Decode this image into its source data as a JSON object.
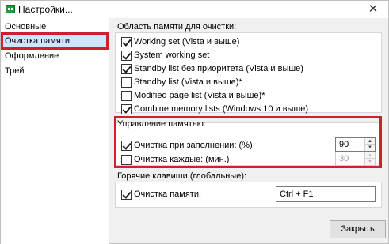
{
  "window": {
    "title": "Настройки..."
  },
  "sidebar": {
    "items": [
      {
        "label": "Основные"
      },
      {
        "label": "Очистка памяти",
        "selected": true
      },
      {
        "label": "Оформление"
      },
      {
        "label": "Трей"
      }
    ]
  },
  "memory_areas": {
    "title": "Область памяти для очистки:",
    "options": [
      {
        "label": "Working set (Vista и выше)",
        "checked": true
      },
      {
        "label": "System working set",
        "checked": true
      },
      {
        "label": "Standby list без приоритета (Vista и выше)",
        "checked": true
      },
      {
        "label": "Standby list (Vista и выше)*",
        "checked": false
      },
      {
        "label": "Modified page list (Vista и выше)*",
        "checked": false
      },
      {
        "label": "Combine memory lists (Windows 10 и выше)",
        "checked": true
      }
    ]
  },
  "memory_management": {
    "title": "Управление памятью:",
    "fill_cleanup": {
      "label": "Очистка при заполнении: (%)",
      "checked": true,
      "value": "90"
    },
    "interval_cleanup": {
      "label": "Очистка каждые: (мин.)",
      "checked": false,
      "value": "30"
    }
  },
  "hotkeys": {
    "title": "Горячие клавиши (глобальные):",
    "memory_cleanup": {
      "label": "Очистка памяти:",
      "checked": true,
      "value": "Ctrl + F1"
    }
  },
  "footer": {
    "close_label": "Закрыть"
  },
  "colors": {
    "highlight_border": "#d0202e",
    "selected_item": "#cce8ff",
    "app_icon": "#1e9e3b"
  }
}
